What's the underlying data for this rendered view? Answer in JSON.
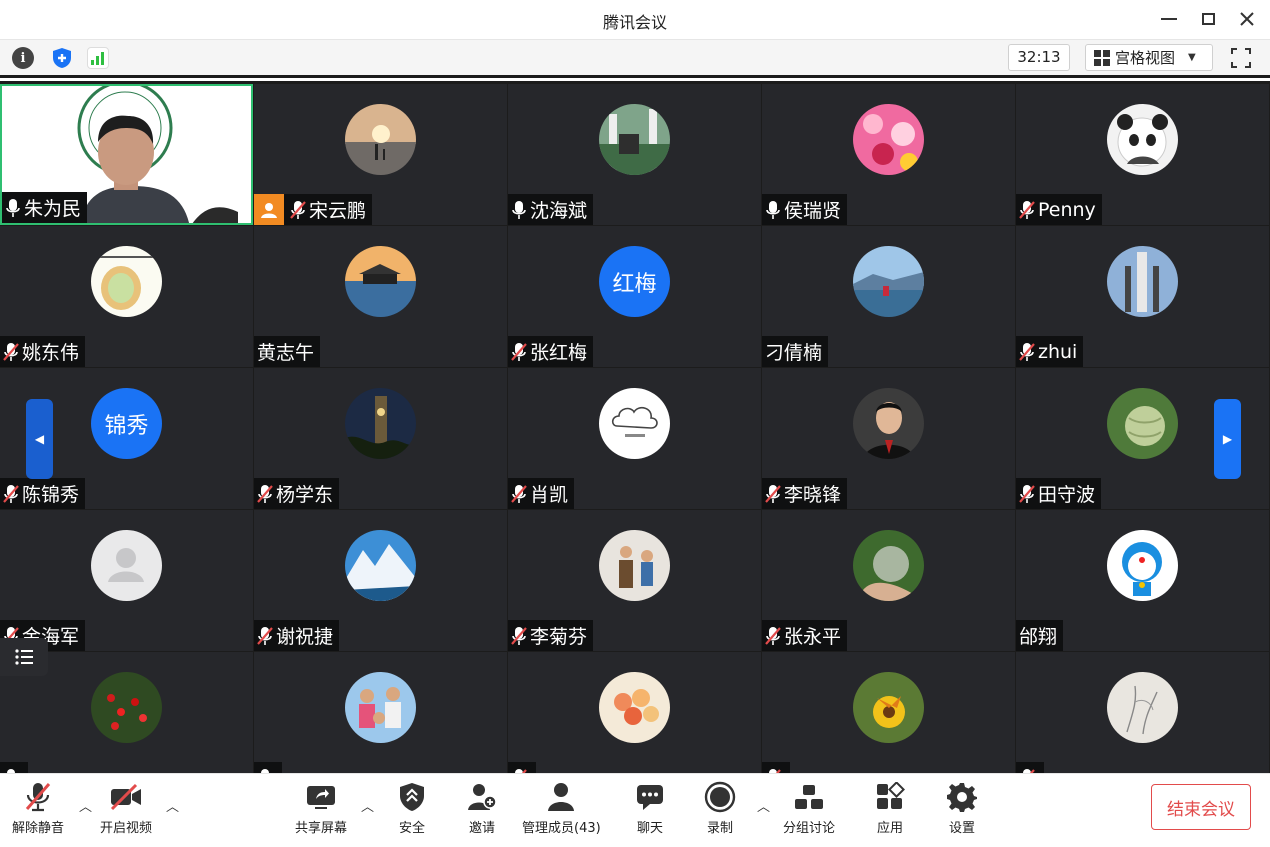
{
  "window": {
    "title": "腾讯会议"
  },
  "infobar": {
    "timer": "32:13",
    "view_label": "宫格视图"
  },
  "participants": [
    {
      "name": "朱为民",
      "mic": "on",
      "type": "video"
    },
    {
      "name": "宋云鹏",
      "mic": "muted",
      "type": "photo",
      "host": true
    },
    {
      "name": "沈海斌",
      "mic": "on",
      "type": "photo"
    },
    {
      "name": "侯瑞贤",
      "mic": "on",
      "type": "photo"
    },
    {
      "name": "Penny",
      "mic": "muted",
      "type": "photo"
    },
    {
      "name": "姚东伟",
      "mic": "muted",
      "type": "photo"
    },
    {
      "name": "黄志午",
      "mic": "none",
      "type": "photo"
    },
    {
      "name": "张红梅",
      "mic": "muted",
      "type": "text",
      "avatar_text": "红梅"
    },
    {
      "name": "刁倩楠",
      "mic": "none",
      "type": "photo"
    },
    {
      "name": "zhui",
      "mic": "muted",
      "type": "photo"
    },
    {
      "name": "陈锦秀",
      "mic": "muted",
      "type": "text",
      "avatar_text": "锦秀"
    },
    {
      "name": "杨学东",
      "mic": "muted",
      "type": "photo"
    },
    {
      "name": "肖凯",
      "mic": "muted",
      "type": "photo"
    },
    {
      "name": "李晓锋",
      "mic": "muted",
      "type": "photo"
    },
    {
      "name": "田守波",
      "mic": "muted",
      "type": "photo"
    },
    {
      "name": "金海军",
      "mic": "muted",
      "type": "default"
    },
    {
      "name": "谢祝捷",
      "mic": "muted",
      "type": "photo"
    },
    {
      "name": "李菊芬",
      "mic": "muted",
      "type": "photo"
    },
    {
      "name": "张永平",
      "mic": "muted",
      "type": "photo"
    },
    {
      "name": "邰翔",
      "mic": "none",
      "type": "photo"
    },
    {
      "name": "",
      "mic": "on",
      "type": "photo"
    },
    {
      "name": "",
      "mic": "on",
      "type": "photo"
    },
    {
      "name": "",
      "mic": "muted",
      "type": "photo"
    },
    {
      "name": "",
      "mic": "muted",
      "type": "photo"
    },
    {
      "name": "",
      "mic": "muted",
      "type": "photo"
    }
  ],
  "toolbar": {
    "unmute": "解除静音",
    "start_video": "开启视频",
    "share_screen": "共享屏幕",
    "security": "安全",
    "invite": "邀请",
    "manage_members": "管理成员(43)",
    "chat": "聊天",
    "record": "录制",
    "breakout": "分组讨论",
    "apps": "应用",
    "settings": "设置",
    "end_meeting": "结束会议"
  },
  "colors": {
    "accent": "#1a73f5",
    "end": "#e24b4b",
    "host_badge": "#f28b22",
    "speaking_border": "#2fbf71"
  }
}
